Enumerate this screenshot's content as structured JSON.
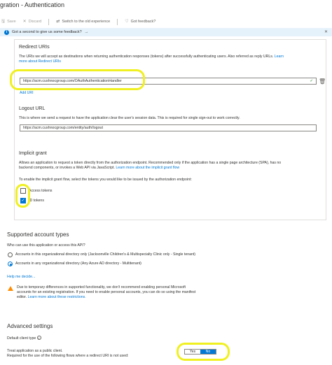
{
  "header": {
    "title": "gration - Authentication"
  },
  "toolbar": {
    "save": "Save",
    "discard": "Discard",
    "switch": "Switch to the old experience",
    "feedback": "Got feedback?"
  },
  "banner": {
    "text": "Got a second to give us some feedback?",
    "arrow": "→"
  },
  "redirect": {
    "heading": "Redirect URIs",
    "desc": "The URIs we will accept as destinations when returning authentication responses (tokens) after successfully authenticating users. Also referred as reply URLs.",
    "learn": "Learn more about Redirect URIs",
    "learn_head": "Learn",
    "learn_tail": "more about Redirect URIs",
    "value": "https://acm.cushnocgroup.com/OAuthAuthenticationHandler",
    "add": "Add URI"
  },
  "logout": {
    "heading": "Logout URL",
    "desc": "This is where we send a request to have the application clear the user's session data. This is required for single sign-out to work correctly.",
    "value": "https://acm.cushnocgroup.com/entity/auth/logout"
  },
  "implicit": {
    "heading": "Implicit grant",
    "desc_line1": "Allows an application to request a token directly from the authorization endpoint. Recommended only if the application has a single page architecture (SPA), has no",
    "desc_line2": "backend components, or invokes a Web API via JavaScript.",
    "learn": "Learn more about the implicit grant flow",
    "prompt": "To enable the implicit grant flow, select the tokens you would like to be issued by the authorization endpoint:",
    "access_tokens": "Access tokens",
    "id_tokens": "ID tokens",
    "access_checked": false,
    "id_checked": true
  },
  "supported": {
    "heading": "Supported account types",
    "question": "Who can use this application or access this API?",
    "option1": "Accounts in this organizational directory only (Jacksonville Children's & Multispecialty Clinic only - Single tenant)",
    "option2": "Accounts in any organizational directory (Any Azure AD directory - Multitenant)",
    "selected": 2,
    "help": "Help me decide...",
    "warning_line1": "Due to temporary differences in supported functionality, we don't recommend enabling personal Microsoft",
    "warning_line2": "accounts for an existing registration. If you need to enable personal accounts, you can do so using the manifest",
    "warning_line3": "editor.",
    "warning_learn": "Learn more about these restrictions."
  },
  "advanced": {
    "heading": "Advanced settings",
    "client_type": "Default client type",
    "public_client": "Treat application as a public client.",
    "required_for": "Required for the use of the following flows where a redirect URI is not used:",
    "yes": "Yes",
    "no": "No",
    "selected": "No"
  },
  "colors": {
    "accent": "#0078d4",
    "highlight": "#f0f020",
    "warning": "#ff8c00"
  }
}
